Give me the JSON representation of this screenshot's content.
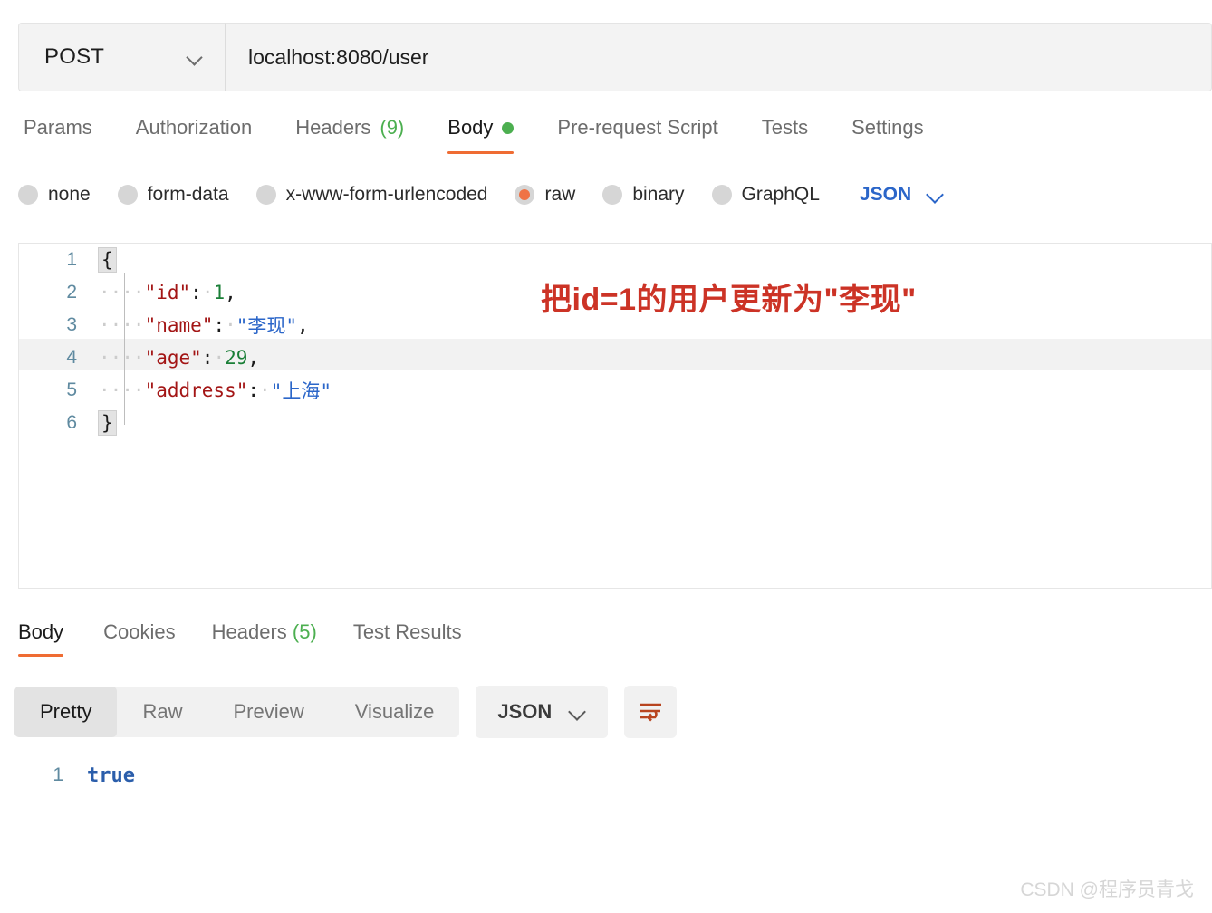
{
  "request": {
    "method": "POST",
    "url": "localhost:8080/user",
    "method_chevron_icon": "chevron-down-icon",
    "tabs": [
      {
        "label": "Params",
        "active": false,
        "count": null,
        "dot": false
      },
      {
        "label": "Authorization",
        "active": false,
        "count": null,
        "dot": false
      },
      {
        "label": "Headers",
        "active": false,
        "count": "(9)",
        "dot": false
      },
      {
        "label": "Body",
        "active": true,
        "count": null,
        "dot": true
      },
      {
        "label": "Pre-request Script",
        "active": false,
        "count": null,
        "dot": false
      },
      {
        "label": "Tests",
        "active": false,
        "count": null,
        "dot": false
      },
      {
        "label": "Settings",
        "active": false,
        "count": null,
        "dot": false
      }
    ],
    "body_types": [
      {
        "label": "none",
        "selected": false
      },
      {
        "label": "form-data",
        "selected": false
      },
      {
        "label": "x-www-form-urlencoded",
        "selected": false
      },
      {
        "label": "raw",
        "selected": true
      },
      {
        "label": "binary",
        "selected": false
      },
      {
        "label": "GraphQL",
        "selected": false
      }
    ],
    "raw_format": "JSON",
    "raw_format_chevron_icon": "chevron-down-icon"
  },
  "editor": {
    "lines": [
      {
        "no": "1",
        "type": "brace_open",
        "text": "{"
      },
      {
        "no": "2",
        "ws": "····",
        "key": "\"id\"",
        "colon": ":",
        "space": "·",
        "value": "1",
        "value_kind": "num",
        "comma": ","
      },
      {
        "no": "3",
        "ws": "····",
        "key": "\"name\"",
        "colon": ":",
        "space": "·",
        "value": "\"李现\"",
        "value_kind": "str",
        "comma": ","
      },
      {
        "no": "4",
        "ws": "····",
        "key": "\"age\"",
        "colon": ":",
        "space": "·",
        "value": "29",
        "value_kind": "num",
        "comma": ",",
        "active": true
      },
      {
        "no": "5",
        "ws": "····",
        "key": "\"address\"",
        "colon": ":",
        "space": "·",
        "value": "\"上海\"",
        "value_kind": "str",
        "comma": ""
      },
      {
        "no": "6",
        "type": "brace_close",
        "text": "}"
      }
    ]
  },
  "annotation": {
    "text": "把id=1的用户更新为\"李现\"",
    "color": "#cc3326"
  },
  "response": {
    "tabs": [
      {
        "label": "Body",
        "active": true,
        "count": null
      },
      {
        "label": "Cookies",
        "active": false,
        "count": null
      },
      {
        "label": "Headers",
        "active": false,
        "count": "(5)"
      },
      {
        "label": "Test Results",
        "active": false,
        "count": null
      }
    ],
    "view_modes": [
      {
        "label": "Pretty",
        "active": true
      },
      {
        "label": "Raw",
        "active": false
      },
      {
        "label": "Preview",
        "active": false
      },
      {
        "label": "Visualize",
        "active": false
      }
    ],
    "format": "JSON",
    "format_chevron_icon": "chevron-down-icon",
    "wrap_icon": "word-wrap-icon",
    "body_lines": [
      {
        "no": "1",
        "value": "true"
      }
    ]
  },
  "watermark": {
    "text": "CSDN @程序员青戈"
  },
  "colors": {
    "accent_orange": "#ef6c33",
    "radio_orange": "#ef7346",
    "link_blue": "#2b66c9",
    "dot_green": "#4caf50",
    "annotation_red": "#cc3326",
    "json_key": "#a31515",
    "json_number": "#1a7f37",
    "json_string": "#2b66c9"
  }
}
